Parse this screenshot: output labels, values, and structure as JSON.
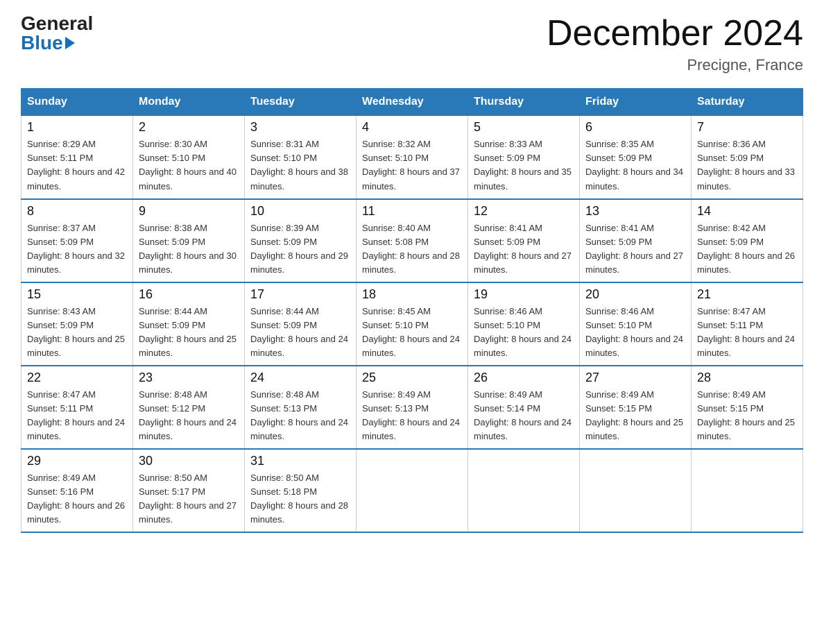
{
  "logo": {
    "general": "General",
    "blue": "Blue"
  },
  "title": "December 2024",
  "subtitle": "Precigne, France",
  "headers": [
    "Sunday",
    "Monday",
    "Tuesday",
    "Wednesday",
    "Thursday",
    "Friday",
    "Saturday"
  ],
  "weeks": [
    [
      {
        "day": "1",
        "sunrise": "8:29 AM",
        "sunset": "5:11 PM",
        "daylight": "8 hours and 42 minutes."
      },
      {
        "day": "2",
        "sunrise": "8:30 AM",
        "sunset": "5:10 PM",
        "daylight": "8 hours and 40 minutes."
      },
      {
        "day": "3",
        "sunrise": "8:31 AM",
        "sunset": "5:10 PM",
        "daylight": "8 hours and 38 minutes."
      },
      {
        "day": "4",
        "sunrise": "8:32 AM",
        "sunset": "5:10 PM",
        "daylight": "8 hours and 37 minutes."
      },
      {
        "day": "5",
        "sunrise": "8:33 AM",
        "sunset": "5:09 PM",
        "daylight": "8 hours and 35 minutes."
      },
      {
        "day": "6",
        "sunrise": "8:35 AM",
        "sunset": "5:09 PM",
        "daylight": "8 hours and 34 minutes."
      },
      {
        "day": "7",
        "sunrise": "8:36 AM",
        "sunset": "5:09 PM",
        "daylight": "8 hours and 33 minutes."
      }
    ],
    [
      {
        "day": "8",
        "sunrise": "8:37 AM",
        "sunset": "5:09 PM",
        "daylight": "8 hours and 32 minutes."
      },
      {
        "day": "9",
        "sunrise": "8:38 AM",
        "sunset": "5:09 PM",
        "daylight": "8 hours and 30 minutes."
      },
      {
        "day": "10",
        "sunrise": "8:39 AM",
        "sunset": "5:09 PM",
        "daylight": "8 hours and 29 minutes."
      },
      {
        "day": "11",
        "sunrise": "8:40 AM",
        "sunset": "5:08 PM",
        "daylight": "8 hours and 28 minutes."
      },
      {
        "day": "12",
        "sunrise": "8:41 AM",
        "sunset": "5:09 PM",
        "daylight": "8 hours and 27 minutes."
      },
      {
        "day": "13",
        "sunrise": "8:41 AM",
        "sunset": "5:09 PM",
        "daylight": "8 hours and 27 minutes."
      },
      {
        "day": "14",
        "sunrise": "8:42 AM",
        "sunset": "5:09 PM",
        "daylight": "8 hours and 26 minutes."
      }
    ],
    [
      {
        "day": "15",
        "sunrise": "8:43 AM",
        "sunset": "5:09 PM",
        "daylight": "8 hours and 25 minutes."
      },
      {
        "day": "16",
        "sunrise": "8:44 AM",
        "sunset": "5:09 PM",
        "daylight": "8 hours and 25 minutes."
      },
      {
        "day": "17",
        "sunrise": "8:44 AM",
        "sunset": "5:09 PM",
        "daylight": "8 hours and 24 minutes."
      },
      {
        "day": "18",
        "sunrise": "8:45 AM",
        "sunset": "5:10 PM",
        "daylight": "8 hours and 24 minutes."
      },
      {
        "day": "19",
        "sunrise": "8:46 AM",
        "sunset": "5:10 PM",
        "daylight": "8 hours and 24 minutes."
      },
      {
        "day": "20",
        "sunrise": "8:46 AM",
        "sunset": "5:10 PM",
        "daylight": "8 hours and 24 minutes."
      },
      {
        "day": "21",
        "sunrise": "8:47 AM",
        "sunset": "5:11 PM",
        "daylight": "8 hours and 24 minutes."
      }
    ],
    [
      {
        "day": "22",
        "sunrise": "8:47 AM",
        "sunset": "5:11 PM",
        "daylight": "8 hours and 24 minutes."
      },
      {
        "day": "23",
        "sunrise": "8:48 AM",
        "sunset": "5:12 PM",
        "daylight": "8 hours and 24 minutes."
      },
      {
        "day": "24",
        "sunrise": "8:48 AM",
        "sunset": "5:13 PM",
        "daylight": "8 hours and 24 minutes."
      },
      {
        "day": "25",
        "sunrise": "8:49 AM",
        "sunset": "5:13 PM",
        "daylight": "8 hours and 24 minutes."
      },
      {
        "day": "26",
        "sunrise": "8:49 AM",
        "sunset": "5:14 PM",
        "daylight": "8 hours and 24 minutes."
      },
      {
        "day": "27",
        "sunrise": "8:49 AM",
        "sunset": "5:15 PM",
        "daylight": "8 hours and 25 minutes."
      },
      {
        "day": "28",
        "sunrise": "8:49 AM",
        "sunset": "5:15 PM",
        "daylight": "8 hours and 25 minutes."
      }
    ],
    [
      {
        "day": "29",
        "sunrise": "8:49 AM",
        "sunset": "5:16 PM",
        "daylight": "8 hours and 26 minutes."
      },
      {
        "day": "30",
        "sunrise": "8:50 AM",
        "sunset": "5:17 PM",
        "daylight": "8 hours and 27 minutes."
      },
      {
        "day": "31",
        "sunrise": "8:50 AM",
        "sunset": "5:18 PM",
        "daylight": "8 hours and 28 minutes."
      },
      null,
      null,
      null,
      null
    ]
  ],
  "labels": {
    "sunrise": "Sunrise:",
    "sunset": "Sunset:",
    "daylight": "Daylight:"
  }
}
